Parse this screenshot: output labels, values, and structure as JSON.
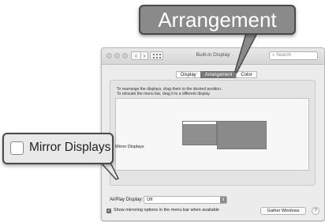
{
  "window": {
    "title": "Built-in Display",
    "nav_back": "‹",
    "nav_forward": "›",
    "search_placeholder": "Search"
  },
  "tabs": [
    {
      "label": "Display",
      "active": false
    },
    {
      "label": "Arrangement",
      "active": true
    },
    {
      "label": "Color",
      "active": false
    }
  ],
  "arrangement": {
    "instruction_1": "To rearrange the displays, drag them to the desired position.",
    "instruction_2": "To relocate the menu bar, drag it to a different display.",
    "mirror_label": "Mirror Displays",
    "mirror_checked": false
  },
  "footer": {
    "airplay_label": "AirPlay Display:",
    "airplay_value": "Off",
    "show_mirroring_label": "Show mirroring options in the menu bar when available",
    "show_mirroring_checked": true,
    "gather_label": "Gather Windows",
    "help_label": "?"
  },
  "callouts": {
    "arrangement_text": "Arrangement",
    "mirror_text": "Mirror Displays"
  },
  "colors": {
    "callout_border": "#4a4a4a",
    "active_tab": "#7a7a7a",
    "display_fill": "#8f8f8f"
  }
}
